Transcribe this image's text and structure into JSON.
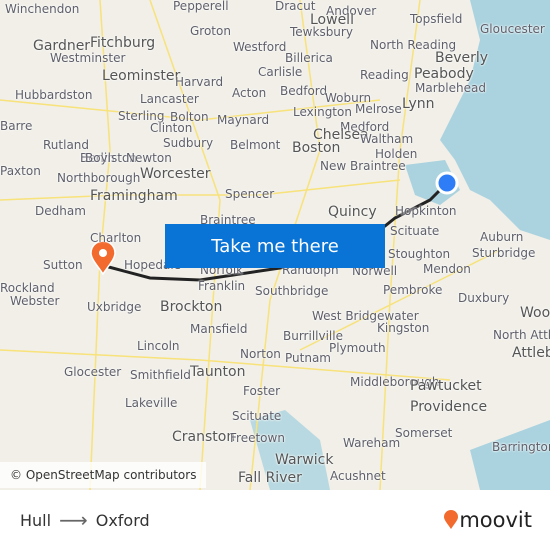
{
  "map": {
    "labels": [
      "Winchendon",
      "Pepperell",
      "Dracut",
      "Andover",
      "Topsfield",
      "Gloucester",
      "Lowell",
      "Tewksbury",
      "Groton",
      "Gardner",
      "Fitchburg",
      "Westford",
      "North Reading",
      "Beverly",
      "Westminster",
      "Billerica",
      "Reading",
      "Peabody",
      "Leominster",
      "Harvard",
      "Carlisle",
      "Marblehead",
      "Hubbardston",
      "Lancaster",
      "Acton",
      "Bedford",
      "Woburn",
      "Melrose",
      "Lynn",
      "Sterling",
      "Bolton",
      "Maynard",
      "Lexington",
      "Clinton",
      "Medford",
      "Barre",
      "Rutland",
      "Berlin",
      "Sudbury",
      "Belmont",
      "Chelsea",
      "Waltham",
      "Boston",
      "Holden",
      "Boylston",
      "Newton",
      "New Braintree",
      "Paxton",
      "Northborough",
      "Worcester",
      "Framingham",
      "Spencer",
      "Dedham",
      "Quincy",
      "Hopkinton",
      "Braintree",
      "Scituate",
      "Auburn",
      "Charlton",
      "Sutton",
      "Hopedale",
      "Norfolk",
      "Randolph",
      "Stoughton",
      "Norwell",
      "Sturbridge",
      "Rockland",
      "Mendon",
      "Franklin",
      "Southbridge",
      "Webster",
      "Uxbridge",
      "Brockton",
      "Pembroke",
      "Duxbury",
      "Woonsocket",
      "Mansfield",
      "West Bridgewater",
      "Kingston",
      "North Attleboro",
      "Burrillville",
      "Lincoln",
      "Norton",
      "Plymouth",
      "Attleboro",
      "Putnam",
      "Glocester",
      "Smithfield",
      "Taunton",
      "Middleborough",
      "Pawtucket",
      "Foster",
      "Lakeville",
      "Providence",
      "Scituate",
      "Cranston",
      "Freetown",
      "Somerset",
      "Wareham",
      "Barrington",
      "Warwick",
      "Fall River",
      "Acushnet"
    ],
    "origin_marker": "Hull",
    "destination_marker": "Oxford",
    "cta_label": "Take me there",
    "attribution": "© OpenStreetMap contributors",
    "colors": {
      "route": "#222222",
      "origin": "#2f7df6",
      "destination": "#f26a2e",
      "button": "#0a74d6",
      "water": "#aad3df"
    }
  },
  "footer": {
    "origin": "Hull",
    "destination": "Oxford",
    "arrow_icon": "arrow-right-icon",
    "brand": "moovit"
  }
}
